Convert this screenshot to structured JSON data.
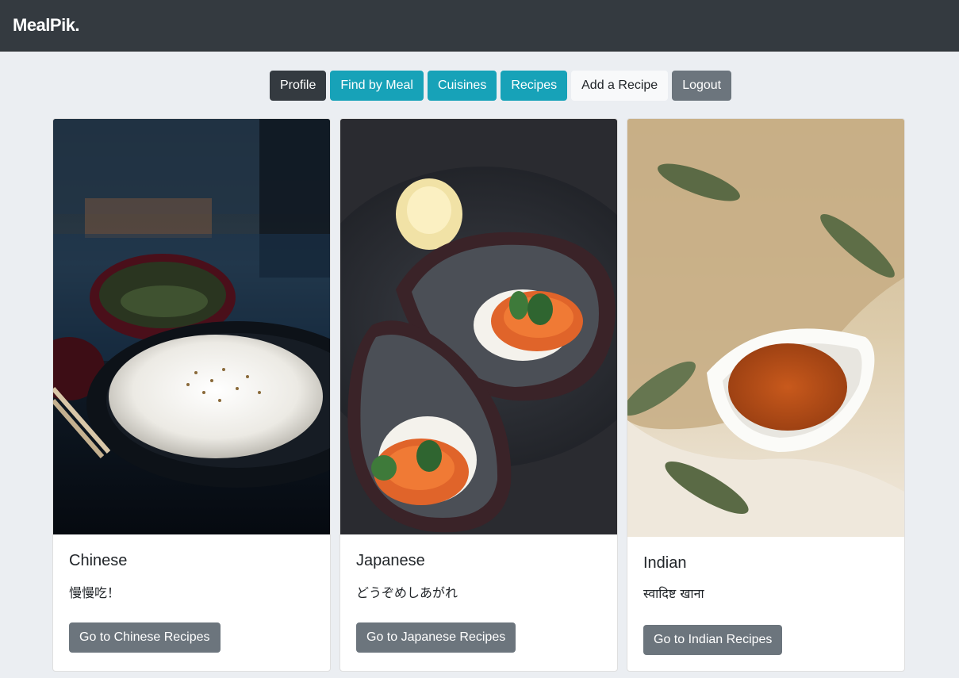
{
  "brand": "MealPik.",
  "nav": {
    "profile": "Profile",
    "find_by_meal": "Find by Meal",
    "cuisines": "Cuisines",
    "recipes": "Recipes",
    "add_recipe": "Add a Recipe",
    "logout": "Logout"
  },
  "cards": [
    {
      "title": "Chinese",
      "text": "慢慢吃！",
      "button": "Go to Chinese Recipes"
    },
    {
      "title": "Japanese",
      "text": "どうぞめしあがれ",
      "button": "Go to Japanese Recipes"
    },
    {
      "title": "Indian",
      "text": "स्वादिष्ट खाना",
      "button": "Go to Indian Recipes"
    }
  ],
  "colors": {
    "navbar": "#343a40",
    "info": "#17a2b8",
    "secondary": "#6c757d",
    "page_bg": "#ebeef2"
  }
}
